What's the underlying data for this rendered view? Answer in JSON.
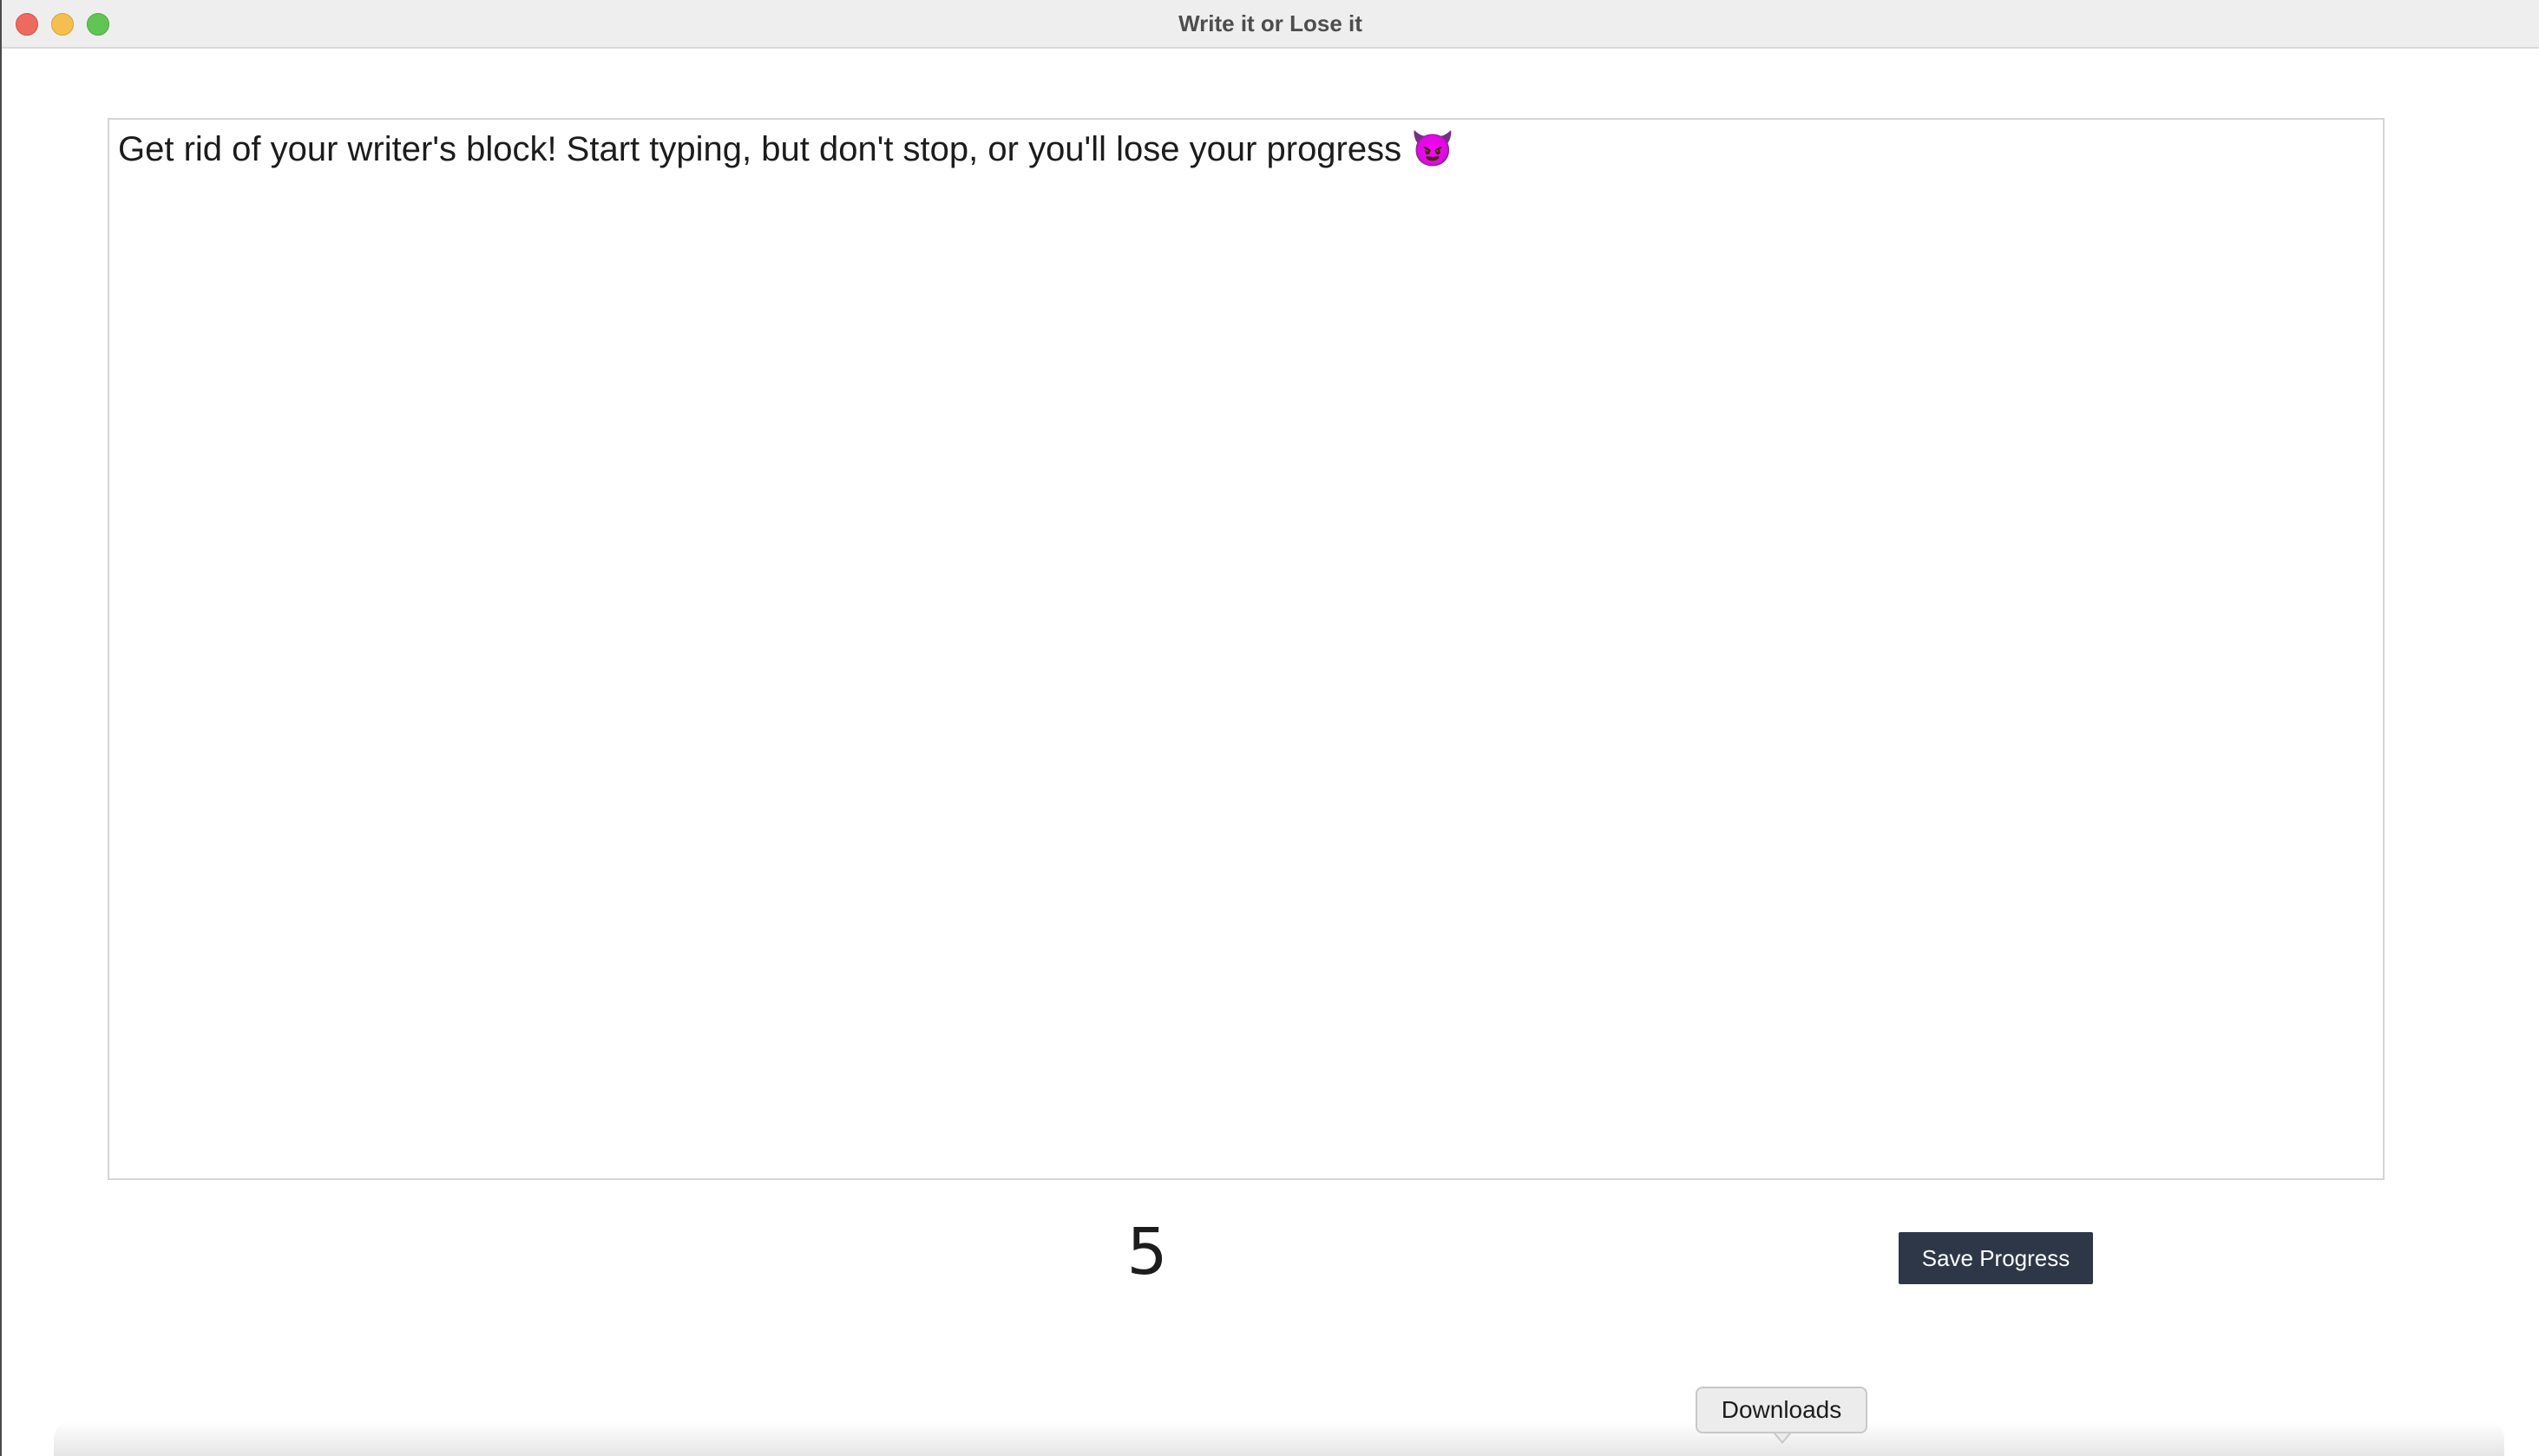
{
  "window": {
    "title": "Write it or Lose it"
  },
  "editor": {
    "placeholder": "Get rid of your writer's block! Start typing, but don't stop, or you'll lose your progress 😈",
    "value": ""
  },
  "timer": {
    "value": "5"
  },
  "actions": {
    "save_label": "Save Progress"
  },
  "dock_tooltip": {
    "label": "Downloads"
  },
  "colors": {
    "button_bg": "#2d3748",
    "close": "#ed6a5e",
    "minimize": "#f5bf4f",
    "maximize": "#61c554"
  }
}
